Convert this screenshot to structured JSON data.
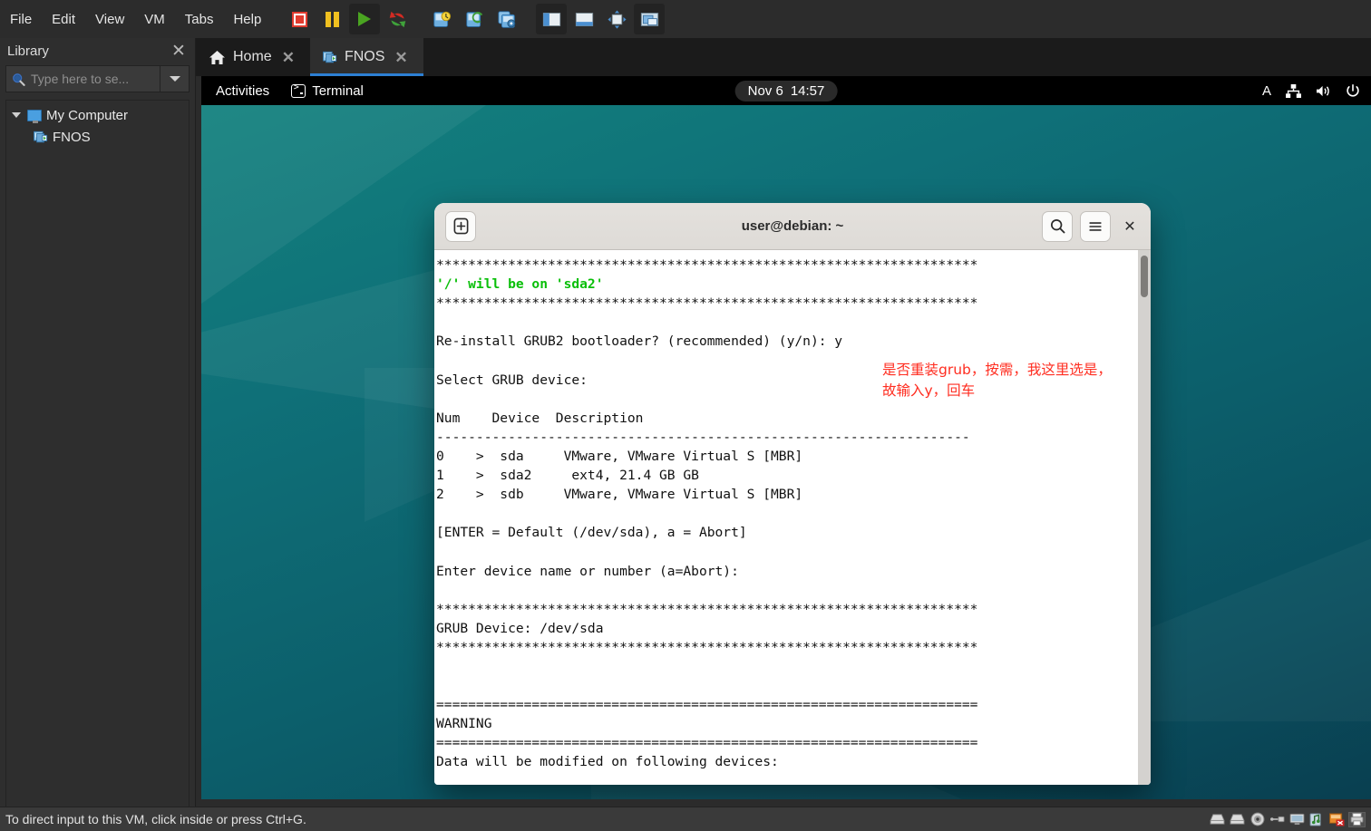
{
  "app": {
    "menus": [
      "File",
      "Edit",
      "View",
      "VM",
      "Tabs",
      "Help"
    ],
    "toolbar_icons": [
      {
        "name": "power-off-icon",
        "label": "Power Off"
      },
      {
        "name": "suspend-pause-icon",
        "label": "Suspend"
      },
      {
        "name": "power-on-play-icon",
        "label": "Power On"
      },
      {
        "name": "restart-guest-icon",
        "label": "Restart Guest"
      },
      {
        "name": "snapshot-take-icon",
        "label": "Take Snapshot"
      },
      {
        "name": "snapshot-revert-icon",
        "label": "Revert Snapshot"
      },
      {
        "name": "snapshot-manager-icon",
        "label": "Snapshot Manager"
      },
      {
        "name": "show-library-icon",
        "label": "Show Library"
      },
      {
        "name": "show-thumbnail-bar-icon",
        "label": "Show Thumbnail Bar"
      },
      {
        "name": "full-screen-icon",
        "label": "Enter Full Screen"
      },
      {
        "name": "unity-mode-icon",
        "label": "Unity Mode"
      }
    ],
    "status_text": "To direct input to this VM, click inside or press Ctrl+G.",
    "status_devices": [
      {
        "name": "hard-disk-1-icon"
      },
      {
        "name": "hard-disk-2-icon"
      },
      {
        "name": "cd-dvd-icon"
      },
      {
        "name": "usb-icon"
      },
      {
        "name": "display-icon"
      },
      {
        "name": "sound-card-icon"
      },
      {
        "name": "network-adapter-disconnected-icon"
      },
      {
        "name": "printer-icon"
      }
    ]
  },
  "library": {
    "title": "Library",
    "close_label": "✕",
    "search": {
      "placeholder": "Type here to se...",
      "value": "",
      "icon": "search-icon",
      "dropdown_icon": "chevron-down-icon"
    },
    "tree": [
      {
        "label": "My Computer",
        "icon": "my-computer-icon",
        "expanded": true,
        "level": 0
      },
      {
        "label": "FNOS",
        "icon": "virtual-machine-icon",
        "expanded": false,
        "level": 1
      }
    ]
  },
  "tabs": [
    {
      "label": "Home",
      "icon": "home-icon",
      "active": false,
      "close": "✕"
    },
    {
      "label": "FNOS",
      "icon": "virtual-machine-icon",
      "active": true,
      "close": "✕"
    }
  ],
  "guest": {
    "topbar": {
      "activities": "Activities",
      "app_name": "Terminal",
      "app_icon": "terminal-icon",
      "clock_date": "Nov 6",
      "clock_time": "14:57",
      "status": {
        "input_method": "A",
        "network_icon": "network-wired-icon",
        "volume_icon": "volume-icon",
        "power_icon": "power-icon"
      }
    },
    "wallpaper_colors": {
      "top": "#13817e",
      "mid": "#0c5f6b",
      "bottom": "#093f50"
    },
    "terminal": {
      "title": "user@debian: ~",
      "buttons": {
        "new_tab": "new-tab-icon",
        "search": "search-icon",
        "menu": "hamburger-menu-icon",
        "close": "✕"
      },
      "lines": [
        {
          "text": "********************************************************************",
          "color": "default"
        },
        {
          "text": "'/' will be on 'sda2'",
          "color": "green"
        },
        {
          "text": "********************************************************************",
          "color": "default"
        },
        {
          "text": "",
          "color": "default"
        },
        {
          "text": "Re-install GRUB2 bootloader? (recommended) (y/n): y",
          "color": "default"
        },
        {
          "text": "",
          "color": "default"
        },
        {
          "text": "Select GRUB device:",
          "color": "default"
        },
        {
          "text": "",
          "color": "default"
        },
        {
          "text": "Num    Device  Description",
          "color": "default"
        },
        {
          "text": "-------------------------------------------------------------------",
          "color": "default"
        },
        {
          "text": "0    >  sda     VMware, VMware Virtual S [MBR]",
          "color": "default"
        },
        {
          "text": "1    >  sda2     ext4, 21.4 GB GB",
          "color": "default"
        },
        {
          "text": "2    >  sdb     VMware, VMware Virtual S [MBR]",
          "color": "default"
        },
        {
          "text": "",
          "color": "default"
        },
        {
          "text": "[ENTER = Default (/dev/sda), a = Abort]",
          "color": "default"
        },
        {
          "text": "",
          "color": "default"
        },
        {
          "text": "Enter device name or number (a=Abort):",
          "color": "default"
        },
        {
          "text": "",
          "color": "default"
        },
        {
          "text": "********************************************************************",
          "color": "default"
        },
        {
          "text": "GRUB Device: /dev/sda",
          "color": "default"
        },
        {
          "text": "********************************************************************",
          "color": "default"
        },
        {
          "text": "",
          "color": "default"
        },
        {
          "text": "",
          "color": "default"
        },
        {
          "text": "====================================================================",
          "color": "default"
        },
        {
          "text": "WARNING",
          "color": "default"
        },
        {
          "text": "====================================================================",
          "color": "default"
        },
        {
          "text": "Data will be modified on following devices:",
          "color": "default"
        }
      ],
      "annotation": "是否重装grub，按需，我这里选是，\n故输入y，回车",
      "annotation_color": "#ff2d20"
    }
  }
}
